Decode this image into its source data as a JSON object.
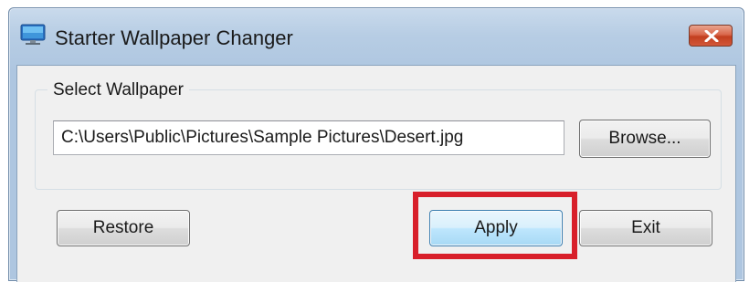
{
  "window": {
    "title": "Starter Wallpaper Changer",
    "app_icon": "monitor-icon",
    "close_icon": "close-icon"
  },
  "group": {
    "label": "Select Wallpaper",
    "path_value": "C:\\Users\\Public\\Pictures\\Sample Pictures\\Desert.jpg",
    "browse_label": "Browse..."
  },
  "buttons": {
    "restore_label": "Restore",
    "apply_label": "Apply",
    "exit_label": "Exit"
  },
  "annotation": {
    "highlight_color": "#d81f2a",
    "highlighted_target": "apply-button"
  }
}
